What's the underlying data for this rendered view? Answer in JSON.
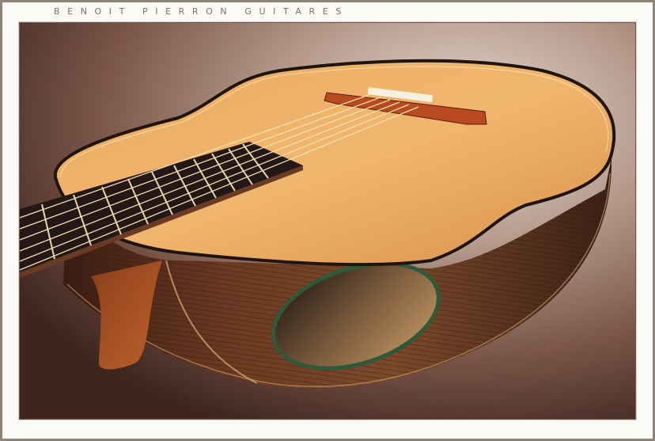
{
  "header": {
    "title": "BENOIT  PIERRON  GUITARES"
  },
  "photo": {
    "subject": "guitar-photo",
    "colors": {
      "background_dark": "#4a3128",
      "background_light": "#c9b8ac",
      "spruce_top": "#e5a45d",
      "rosewood_side": "#5a2e1a",
      "fretboard": "#2a1d1a",
      "bridge": "#b94a1f",
      "strings": "#f3e2b3",
      "frame_border": "#8f8478"
    }
  }
}
